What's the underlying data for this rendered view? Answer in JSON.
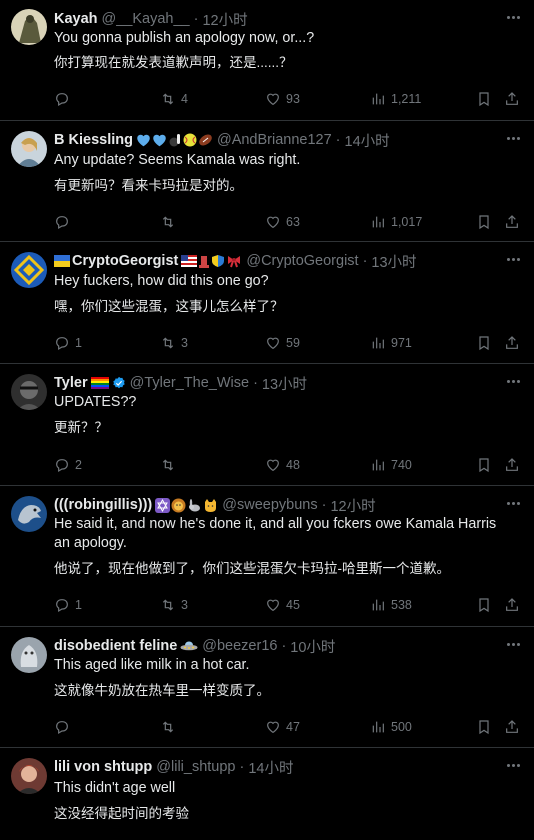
{
  "tweets": [
    {
      "name": "Kayah",
      "badges": [],
      "handle": "@__Kayah__",
      "time": "12小时",
      "text": "You gonna publish an apology now, or...?",
      "translation": "你打算现在就发表道歉声明，还是......？",
      "replies": "",
      "retweets": "4",
      "likes": "93",
      "views": "1,211",
      "avatar_color": "#5a5a3c"
    },
    {
      "name": "B Kiessling",
      "badges": [
        "blue-heart",
        "blue-heart",
        "bowling",
        "softball",
        "football"
      ],
      "handle": "@AndBrianne127",
      "time": "14小时",
      "text": "Any update? Seems Kamala was right.",
      "translation": "有更新吗？看来卡玛拉是对的。",
      "replies": "",
      "retweets": "",
      "likes": "63",
      "views": "1,017",
      "avatar_color": "#8fa3b3"
    },
    {
      "name": "CryptoGeorgist",
      "badges": [
        "ukraine-flag",
        "us-flag",
        "chess",
        "shield",
        "ribbon"
      ],
      "handle": "@CryptoGeorgist",
      "time": "13小时",
      "text": "Hey fuckers, how did this one go?",
      "translation": "嘿，你们这些混蛋，这事儿怎么样了？",
      "replies": "1",
      "retweets": "3",
      "likes": "59",
      "views": "971",
      "avatar_color": "#1c5bb8"
    },
    {
      "name": "Tyler",
      "badges": [
        "rainbow-flag"
      ],
      "verified": true,
      "handle": "@Tyler_The_Wise",
      "time": "13小时",
      "text": "UPDATES??",
      "translation": "更新？？",
      "replies": "2",
      "retweets": "",
      "likes": "48",
      "views": "740",
      "avatar_color": "#4a4a4a"
    },
    {
      "name": "(((robingillis)))",
      "badges": [
        "star-of-david",
        "lion",
        "rabbit",
        "cat"
      ],
      "handle": "@sweepybuns",
      "time": "12小时",
      "text": "He said it, and now he's done it, and all you fckers owe Kamala Harris an apology.",
      "translation": "他说了，现在他做到了，你们这些混蛋欠卡玛拉-哈里斯一个道歉。",
      "replies": "1",
      "retweets": "3",
      "likes": "45",
      "views": "538",
      "avatar_color": "#1d4f8a"
    },
    {
      "name": "disobedient feline",
      "badges": [
        "ufo"
      ],
      "handle": "@beezer16",
      "time": "10小时",
      "text": "This aged like milk in a hot car.",
      "translation": "这就像牛奶放在热车里一样变质了。",
      "replies": "",
      "retweets": "",
      "likes": "47",
      "views": "500",
      "avatar_color": "#8a8e95"
    },
    {
      "name": "lili von shtupp",
      "badges": [],
      "handle": "@lili_shtupp",
      "time": "14小时",
      "text": "This didn't age well",
      "translation": "这没经得起时间的考验",
      "replies": "",
      "retweets": "",
      "likes": "",
      "views": "",
      "avatar_color": "#a0574a"
    }
  ],
  "colors": {
    "background": "#000000",
    "text": "#e7e9ea",
    "muted": "#71767b",
    "divider": "#2f3336",
    "verified": "#1d9bf0"
  }
}
